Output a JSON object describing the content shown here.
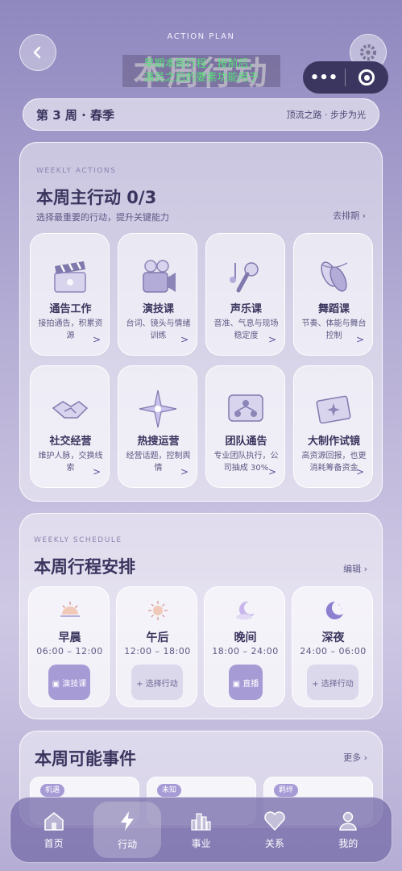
{
  "header": {
    "kicker": "ACTION PLAN",
    "title": "本周行动",
    "overlay_note": "早期本周行程：按前后，\n演员之后的要素功能用于"
  },
  "week_bar": {
    "week": "第 3 周 · 春季",
    "motto": "顶流之路 · 步步为光"
  },
  "main_actions": {
    "kicker": "WEEKLY ACTIONS",
    "title": "本周主行动 0/3",
    "subtitle": "选择最重要的行动，提升关键能力",
    "link": "去排期 ›",
    "cards": [
      {
        "name": "通告工作",
        "desc": "接拍通告，积累资源",
        "icon": "clapperboard-icon"
      },
      {
        "name": "演技课",
        "desc": "台词、镜头与情绪训练",
        "icon": "film-camera-icon"
      },
      {
        "name": "声乐课",
        "desc": "音准、气息与现场稳定度",
        "icon": "microphone-icon"
      },
      {
        "name": "舞蹈课",
        "desc": "节奏、体能与舞台控制",
        "icon": "ballet-shoes-icon"
      },
      {
        "name": "社交经营",
        "desc": "维护人脉，交换线索",
        "icon": "handshake-icon"
      },
      {
        "name": "热搜运营",
        "desc": "经营话题，控制舆情",
        "icon": "sparkle-icon"
      },
      {
        "name": "团队通告",
        "desc": "专业团队执行，公司抽成 30%",
        "icon": "team-network-icon"
      },
      {
        "name": "大制作试镜",
        "desc": "高资源回报，也更消耗筹备资金",
        "icon": "film-strip-icon"
      }
    ]
  },
  "schedule": {
    "kicker": "WEEKLY SCHEDULE",
    "title": "本周行程安排",
    "link": "编辑 ›",
    "slots": [
      {
        "name": "早晨",
        "time": "06:00 – 12:00",
        "action": "▣ 演技课",
        "filled": true,
        "icon": "sunrise-icon"
      },
      {
        "name": "午后",
        "time": "12:00 – 18:00",
        "action": "+ 选择行动",
        "filled": false,
        "icon": "sun-icon"
      },
      {
        "name": "晚间",
        "time": "18:00 – 24:00",
        "action": "▣ 直播",
        "filled": true,
        "icon": "crescent-cloud-icon"
      },
      {
        "name": "深夜",
        "time": "24:00 – 06:00",
        "action": "+ 选择行动",
        "filled": false,
        "icon": "moon-stars-icon"
      }
    ]
  },
  "events": {
    "title": "本周可能事件",
    "link": "更多 ›",
    "tags": [
      "机遇",
      "未知",
      "羁绊"
    ]
  },
  "nav": [
    {
      "label": "首页",
      "icon": "home-icon",
      "active": false
    },
    {
      "label": "行动",
      "icon": "lightning-icon",
      "active": true
    },
    {
      "label": "事业",
      "icon": "city-icon",
      "active": false
    },
    {
      "label": "关系",
      "icon": "heart-icon",
      "active": false
    },
    {
      "label": "我的",
      "icon": "user-icon",
      "active": false
    }
  ],
  "colors": {
    "accent": "#a79bd6",
    "text": "#3a355e",
    "nav": "#786eaa"
  }
}
